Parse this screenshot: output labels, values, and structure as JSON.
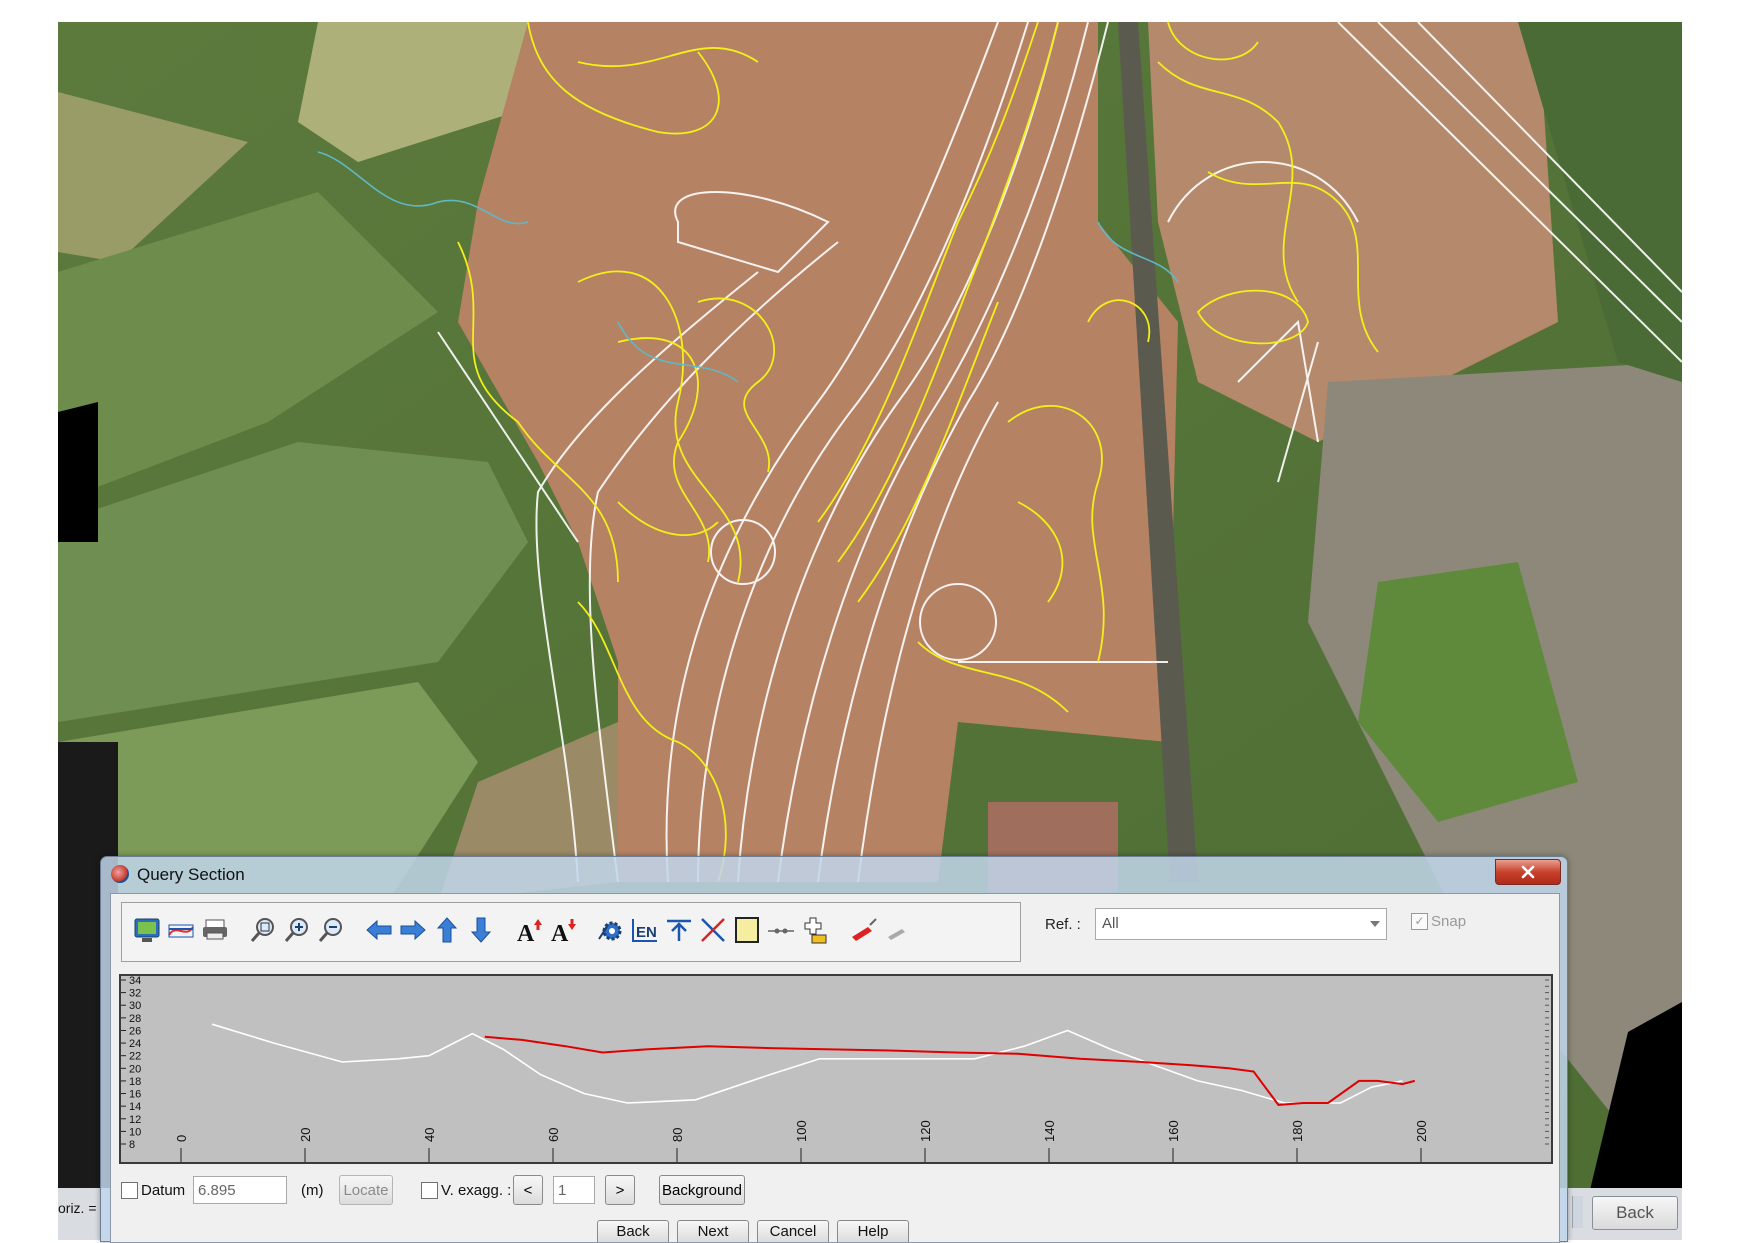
{
  "background": {
    "horiz_label": "oriz. =",
    "back_button": "Back"
  },
  "dialog": {
    "title": "Query Section",
    "toolbar_icons": [
      "view-icon",
      "section-line-icon",
      "print-icon",
      "zoom-window-icon",
      "zoom-in-icon",
      "zoom-out-icon",
      "pan-left-icon",
      "pan-right-icon",
      "pan-up-icon",
      "pan-down-icon",
      "text-larger-icon",
      "text-smaller-icon",
      "settings-icon",
      "en-label-icon",
      "level-marker-icon",
      "cross-line-icon",
      "yellow-box-icon",
      "connector-icon",
      "add-point-icon",
      "red-pen-icon",
      "grey-pen-icon"
    ],
    "ref_label": "Ref. :",
    "ref_value": "All",
    "snap_label": "Snap",
    "snap_checked": true,
    "datum_label": "Datum",
    "datum_value": "6.895",
    "datum_unit": "(m)",
    "locate_label": "Locate",
    "vexagg_label": "V. exagg. :",
    "vexagg_value": "1",
    "prev_label": "<",
    "next_label": ">",
    "background_label": "Background",
    "bottom_buttons": [
      "Back",
      "Next",
      "Cancel",
      "Help"
    ]
  },
  "chart_data": {
    "type": "line",
    "xlim": [
      0,
      200
    ],
    "ylim": [
      8,
      34
    ],
    "x_ticks": [
      "0",
      "20",
      "40",
      "60",
      "80",
      "100",
      "120",
      "140",
      "160",
      "180",
      "200"
    ],
    "y_ticks": [
      "34",
      "32",
      "30",
      "28",
      "26",
      "24",
      "22",
      "20",
      "18",
      "16",
      "14",
      "12",
      "10",
      "8"
    ],
    "series": [
      {
        "color": "#ffffff",
        "x": [
          5,
          15,
          26,
          35,
          40,
          44,
          47,
          52,
          58,
          65,
          72,
          83,
          95,
          103,
          115,
          128,
          136,
          143,
          150,
          157,
          164,
          171,
          178,
          182,
          187,
          192,
          197
        ],
        "y": [
          27,
          24,
          21,
          21.5,
          22,
          24,
          25.5,
          23,
          19,
          16,
          14.5,
          15,
          19,
          21.5,
          21.5,
          21.5,
          23.5,
          26,
          23,
          20.5,
          18,
          16.5,
          14.5,
          14.5,
          14.5,
          17,
          18
        ]
      },
      {
        "color": "#e00000",
        "x": [
          49,
          55,
          62,
          68,
          75,
          85,
          95,
          105,
          115,
          125,
          135,
          145,
          155,
          163,
          169,
          173,
          177,
          181,
          185,
          190,
          193,
          197,
          199
        ],
        "y": [
          25,
          24.5,
          23.5,
          22.5,
          23,
          23.5,
          23.2,
          23,
          22.8,
          22.5,
          22.3,
          21.5,
          21,
          20.5,
          20,
          19.5,
          14.2,
          14.5,
          14.5,
          18,
          18,
          17.5,
          18
        ]
      }
    ]
  }
}
